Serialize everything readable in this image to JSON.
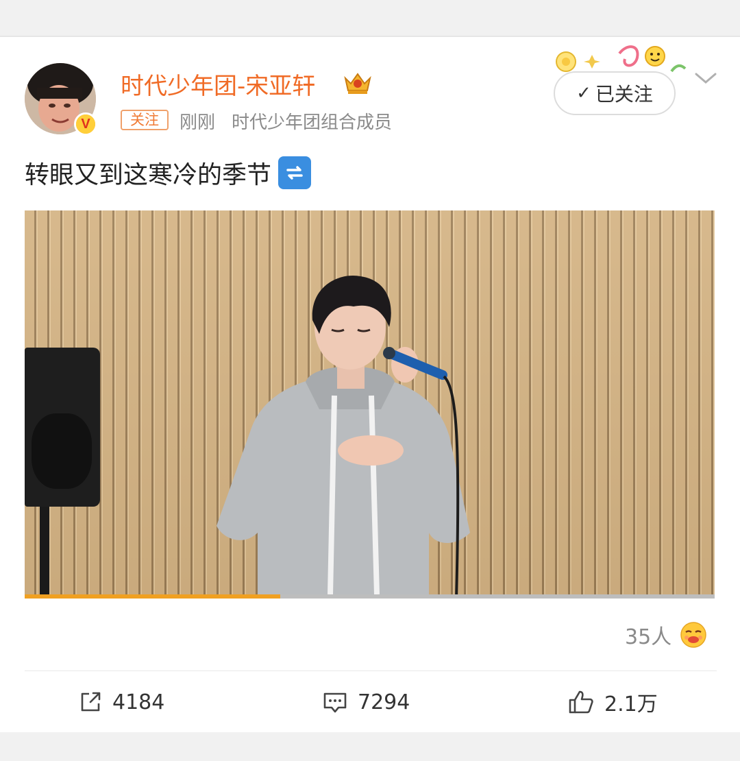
{
  "post": {
    "username": "时代少年团-宋亚轩",
    "follow_tag": "关注",
    "time": "刚刚",
    "description": "时代少年团组合成员",
    "followed_label": "已关注",
    "text": "转眼又到这寒冷的季节"
  },
  "video": {
    "progress": 0.37
  },
  "reactions": {
    "count": "35人"
  },
  "actions": {
    "repost_count": "4184",
    "comment_count": "7294",
    "like_count": "2.1万"
  },
  "icons": {
    "verified": "verified-v-badge-icon",
    "crown": "crown-icon",
    "check": "check-icon",
    "chevron": "chevron-down-icon",
    "repeat": "repeat-emoji-icon",
    "reaction": "sleepy-face-emoji-icon",
    "repost": "share-out-icon",
    "comment": "comment-icon",
    "like": "thumbs-up-icon"
  },
  "colors": {
    "username": "#f06b26",
    "accent_orange": "#f0a021",
    "meta_gray": "#8a8a8a",
    "repeat_blue": "#3a8ee0"
  }
}
